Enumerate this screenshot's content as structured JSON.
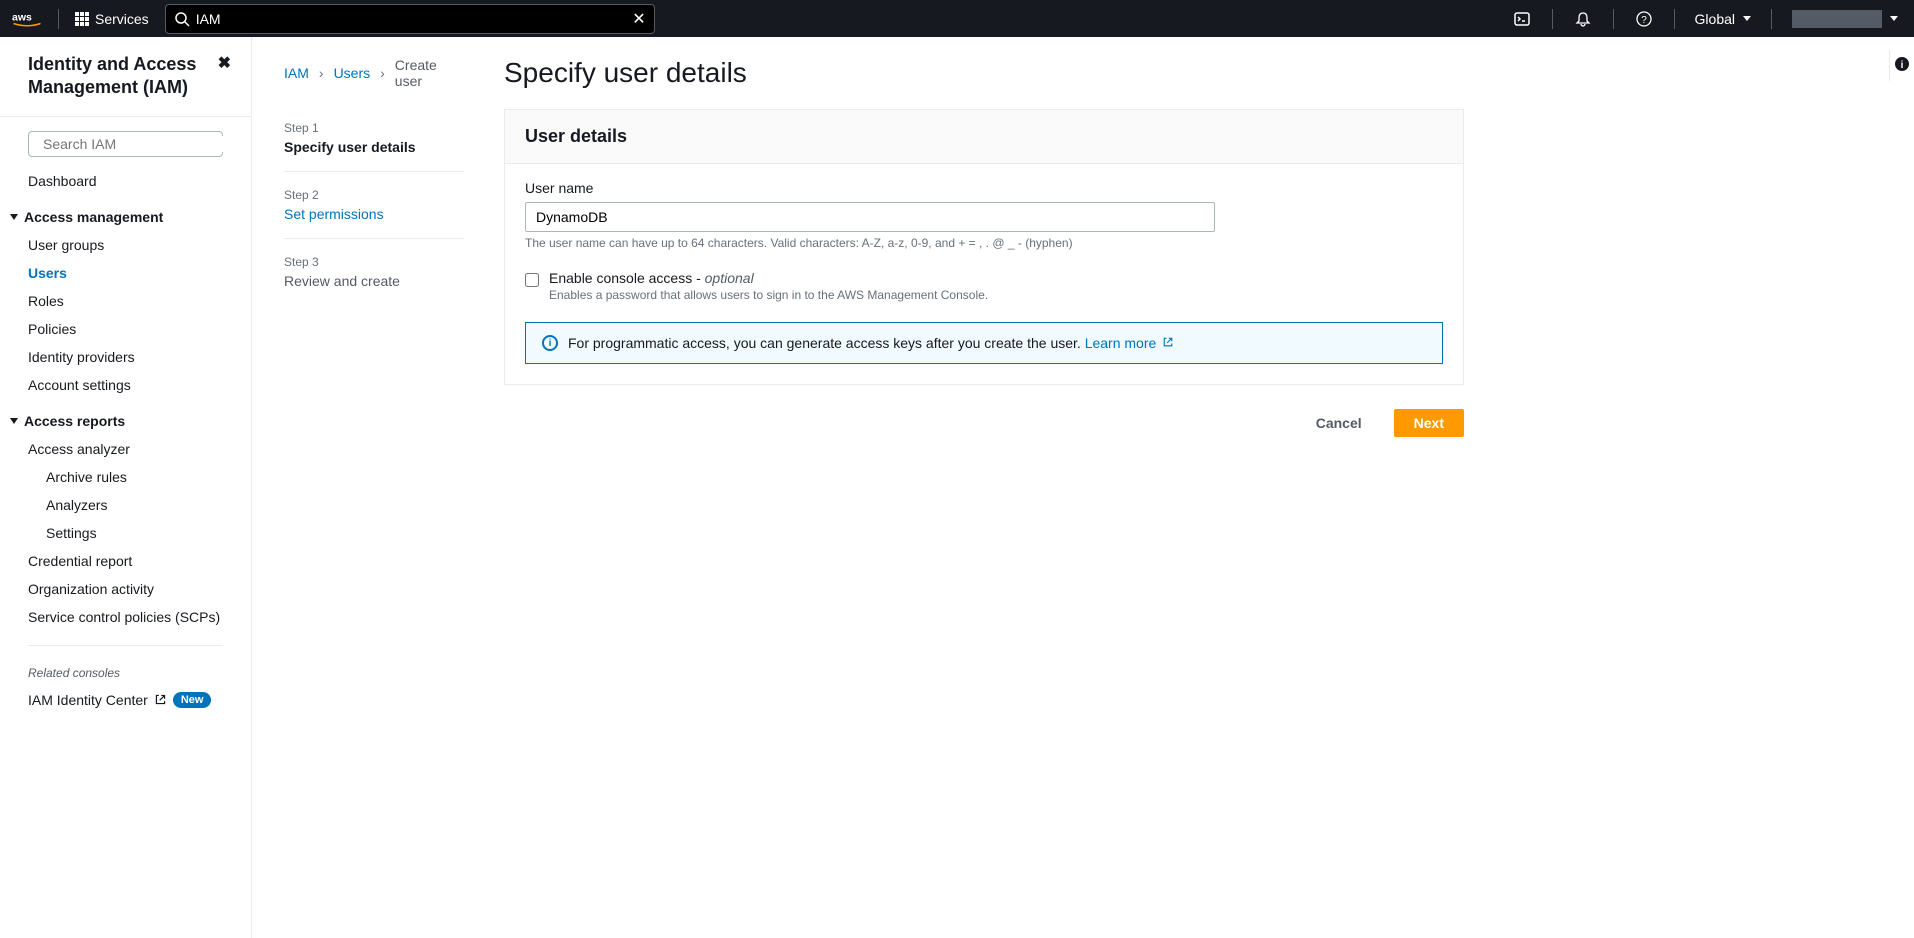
{
  "top_nav": {
    "services_label": "Services",
    "search_value": "IAM",
    "region": "Global"
  },
  "sidebar": {
    "title": "Identity and Access Management (IAM)",
    "search_placeholder": "Search IAM",
    "dashboard": "Dashboard",
    "sections": {
      "access_management": {
        "label": "Access management",
        "items": [
          "User groups",
          "Users",
          "Roles",
          "Policies",
          "Identity providers",
          "Account settings"
        ]
      },
      "access_reports": {
        "label": "Access reports",
        "items": [
          "Access analyzer",
          "Credential report",
          "Organization activity",
          "Service control policies (SCPs)"
        ],
        "analyzer_sub": [
          "Archive rules",
          "Analyzers",
          "Settings"
        ]
      }
    },
    "related_label": "Related consoles",
    "related_item": "IAM Identity Center",
    "new_badge": "New"
  },
  "breadcrumb": {
    "iam": "IAM",
    "users": "Users",
    "create": "Create user"
  },
  "wizard": {
    "step1_num": "Step 1",
    "step1_title": "Specify user details",
    "step2_num": "Step 2",
    "step2_title": "Set permissions",
    "step3_num": "Step 3",
    "step3_title": "Review and create"
  },
  "page": {
    "title": "Specify user details",
    "panel_title": "User details",
    "username_label": "User name",
    "username_value": "DynamoDB",
    "username_hint": "The user name can have up to 64 characters. Valid characters: A-Z, a-z, 0-9, and + = , . @ _ - (hyphen)",
    "console_label": "Enable console access - ",
    "console_optional": "optional",
    "console_desc": "Enables a password that allows users to sign in to the AWS Management Console.",
    "info_text": "For programmatic access, you can generate access keys after you create the user. ",
    "learn_more": "Learn more",
    "cancel": "Cancel",
    "next": "Next"
  }
}
